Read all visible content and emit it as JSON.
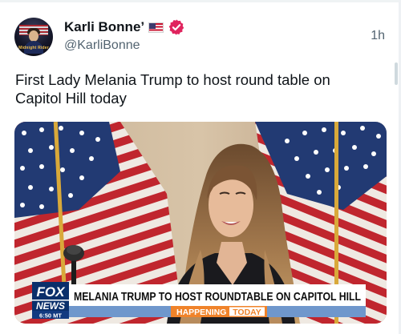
{
  "post": {
    "author": {
      "display_name": "Karli Bonne’",
      "handle": "@KarliBonne",
      "avatar_label": "Midnight Rider",
      "badges": [
        "us-flag-emoji",
        "verified-badge-icon"
      ]
    },
    "timestamp": "1h",
    "text": "First Lady Melania Trump to host round table on Capitol Hill today",
    "media": {
      "network_logo_line1": "FOX",
      "network_logo_line2": "NEWS",
      "clock": "6:50 MT",
      "headline": "MELANIA TRUMP TO HOST ROUNDTABLE ON CAPITOL HILL",
      "ticker_label": "HAPPENING",
      "ticker_today": "TODAY"
    }
  },
  "colors": {
    "verified_badge": "#e0245e",
    "text_primary": "#0f1419",
    "text_secondary": "#536471",
    "fox_blue": "#0a2f6b",
    "ticker_orange": "#f0832a"
  }
}
